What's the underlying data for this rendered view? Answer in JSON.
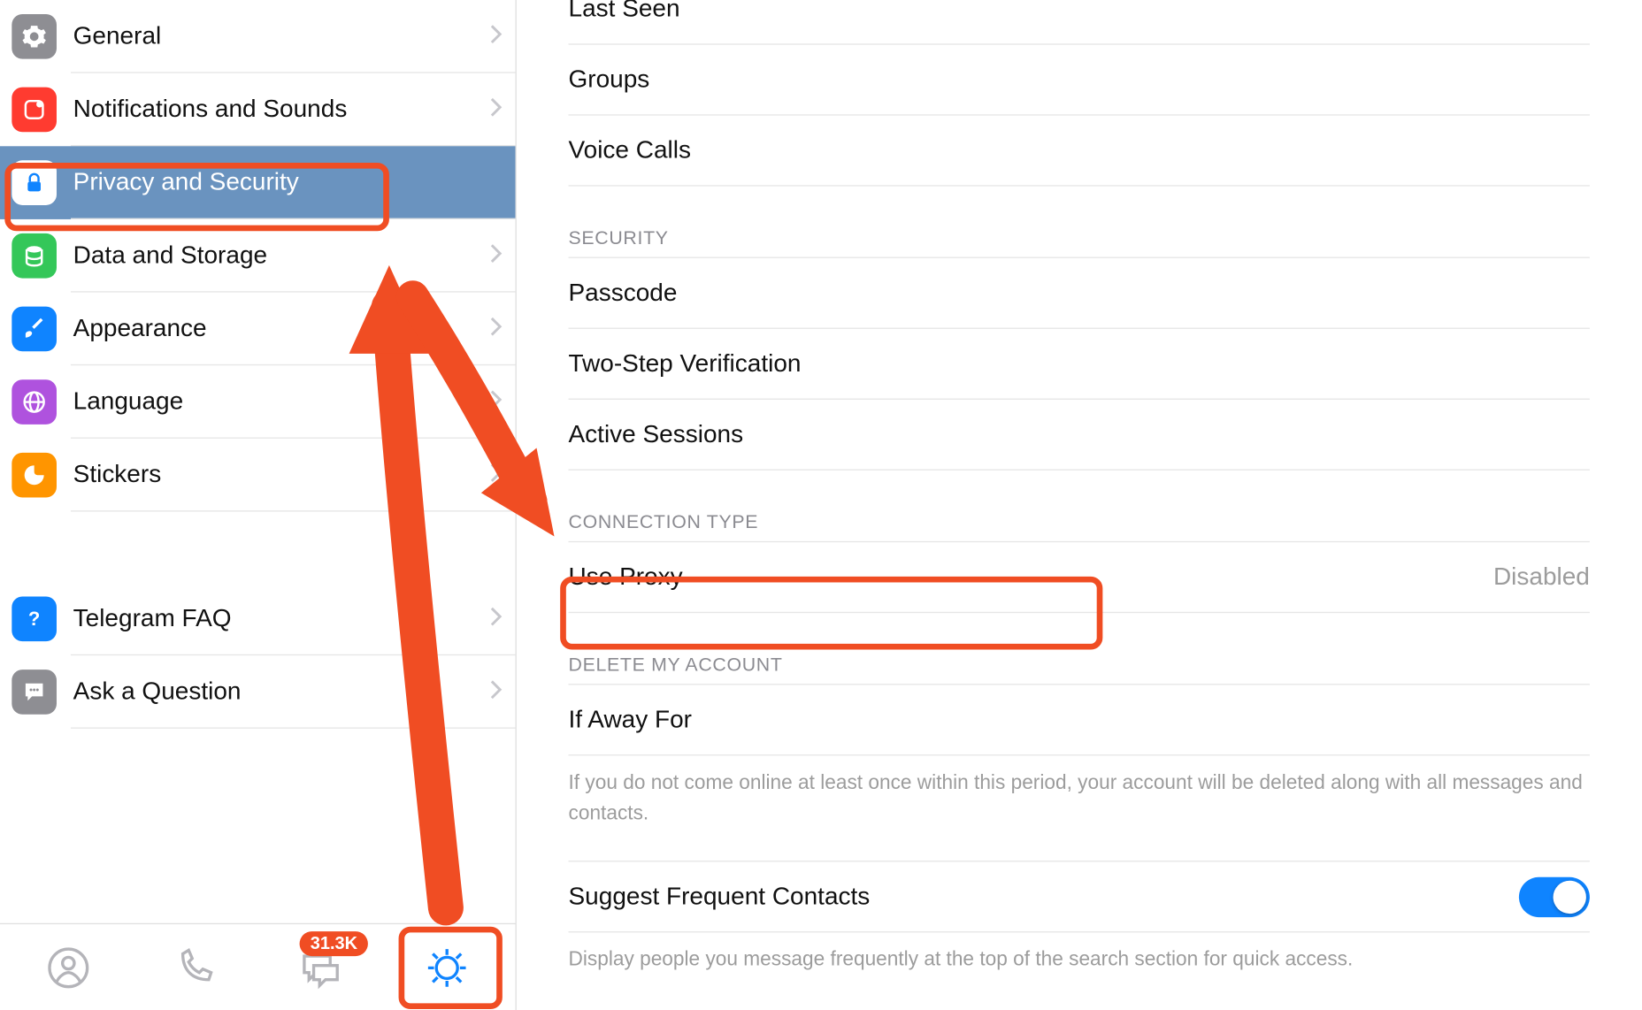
{
  "sidebar": {
    "items": [
      {
        "id": "general",
        "label": "General",
        "icon": "gear",
        "color": "#8e8e93",
        "selected": false,
        "highlight": false
      },
      {
        "id": "notif",
        "label": "Notifications and Sounds",
        "icon": "bell",
        "color": "#ff3b30",
        "selected": false,
        "highlight": false
      },
      {
        "id": "privacy",
        "label": "Privacy and Security",
        "icon": "lock",
        "color": "#0f84ff",
        "selected": true,
        "highlight": true
      },
      {
        "id": "data",
        "label": "Data and Storage",
        "icon": "database",
        "color": "#34c759",
        "selected": false,
        "highlight": false
      },
      {
        "id": "appearance",
        "label": "Appearance",
        "icon": "brush",
        "color": "#0f84ff",
        "selected": false,
        "highlight": false
      },
      {
        "id": "language",
        "label": "Language",
        "icon": "globe",
        "color": "#af52de",
        "selected": false,
        "highlight": false
      },
      {
        "id": "stickers",
        "label": "Stickers",
        "icon": "sticker",
        "color": "#ff9500",
        "selected": false,
        "highlight": false
      }
    ],
    "help_items": [
      {
        "id": "faq",
        "label": "Telegram FAQ",
        "icon": "question",
        "color": "#0f84ff"
      },
      {
        "id": "ask",
        "label": "Ask a Question",
        "icon": "chat",
        "color": "#8e8e93"
      }
    ]
  },
  "tabbar": {
    "contacts": {
      "name": "contacts-tab"
    },
    "calls": {
      "name": "calls-tab"
    },
    "chats": {
      "name": "chats-tab",
      "badge": "31.3K"
    },
    "settings": {
      "name": "settings-tab",
      "active": true,
      "highlight": true
    }
  },
  "content": {
    "privacy_section": {
      "rows": [
        {
          "label": "Last Seen"
        },
        {
          "label": "Groups"
        },
        {
          "label": "Voice Calls"
        }
      ]
    },
    "security_section": {
      "header": "SECURITY",
      "rows": [
        {
          "label": "Passcode"
        },
        {
          "label": "Two-Step Verification"
        },
        {
          "label": "Active Sessions"
        }
      ]
    },
    "connection_section": {
      "header": "CONNECTION TYPE",
      "rows": [
        {
          "label": "Use Proxy",
          "value": "Disabled",
          "highlight": true
        }
      ]
    },
    "delete_section": {
      "header": "DELETE MY ACCOUNT",
      "rows": [
        {
          "label": "If Away For"
        }
      ],
      "footer": "If you do not come online at least once within this period, your account will be deleted along with all messages and contacts."
    },
    "contacts_section": {
      "rows": [
        {
          "label": "Suggest Frequent Contacts",
          "toggle": true
        }
      ],
      "footer": "Display people you message frequently at the top of the search section for quick access."
    }
  },
  "annotations": {
    "color": "#f04d23"
  }
}
